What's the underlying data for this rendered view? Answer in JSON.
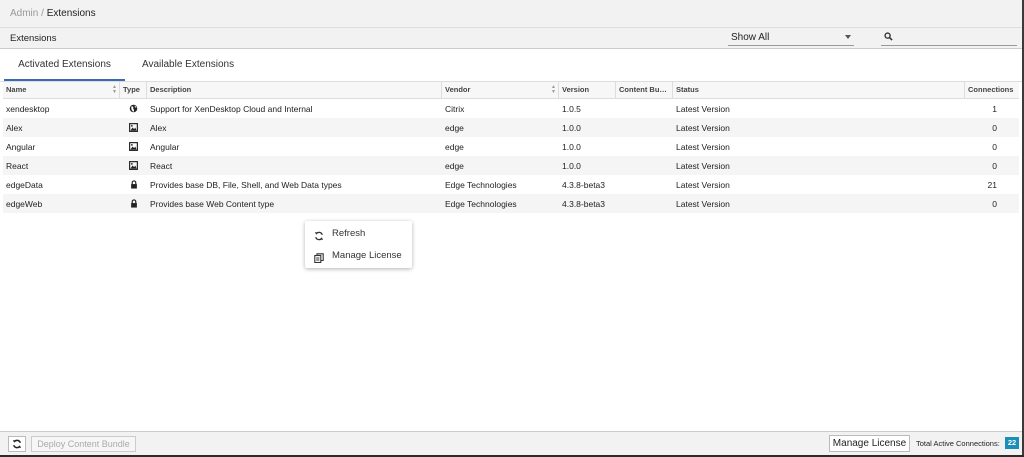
{
  "breadcrumb": {
    "root": "Admin",
    "separator": "/",
    "current": "Extensions"
  },
  "toolbar": {
    "title": "Extensions",
    "filter_value": "Show All",
    "search_placeholder": ""
  },
  "tabs": [
    {
      "label": "Activated Extensions",
      "active": true
    },
    {
      "label": "Available Extensions",
      "active": false
    }
  ],
  "columns": {
    "name": "Name",
    "type": "Type",
    "description": "Description",
    "vendor": "Vendor",
    "version": "Version",
    "content_bundle": "Content Bu…",
    "status": "Status",
    "connections": "Connections"
  },
  "rows": [
    {
      "name": "xendesktop",
      "type_icon": "globe-icon",
      "description": "Support for XenDesktop Cloud and Internal",
      "vendor": "Citrix",
      "version": "1.0.5",
      "content_bundle": "",
      "status": "Latest Version",
      "connections": "1"
    },
    {
      "name": "Alex",
      "type_icon": "image-icon",
      "description": "Alex",
      "vendor": "edge",
      "version": "1.0.0",
      "content_bundle": "",
      "status": "Latest Version",
      "connections": "0"
    },
    {
      "name": "Angular",
      "type_icon": "image-icon",
      "description": "Angular",
      "vendor": "edge",
      "version": "1.0.0",
      "content_bundle": "",
      "status": "Latest Version",
      "connections": "0"
    },
    {
      "name": "React",
      "type_icon": "image-icon",
      "description": "React",
      "vendor": "edge",
      "version": "1.0.0",
      "content_bundle": "",
      "status": "Latest Version",
      "connections": "0"
    },
    {
      "name": "edgeData",
      "type_icon": "lock-icon",
      "description": "Provides base DB, File, Shell, and Web Data types",
      "vendor": "Edge Technologies",
      "version": "4.3.8-beta3",
      "content_bundle": "",
      "status": "Latest Version",
      "connections": "21"
    },
    {
      "name": "edgeWeb",
      "type_icon": "lock-icon",
      "description": "Provides base Web Content type",
      "vendor": "Edge Technologies",
      "version": "4.3.8-beta3",
      "content_bundle": "",
      "status": "Latest Version",
      "connections": "0"
    }
  ],
  "context_menu": {
    "refresh_label": "Refresh",
    "manage_license_label": "Manage License"
  },
  "footer": {
    "deploy_label": "Deploy Content Bundle",
    "manage_license_label": "Manage License",
    "total_label": "Total Active Connections:",
    "total_value": "22"
  },
  "colors": {
    "accent": "#3a6ab5",
    "badge": "#1a8fb8"
  }
}
